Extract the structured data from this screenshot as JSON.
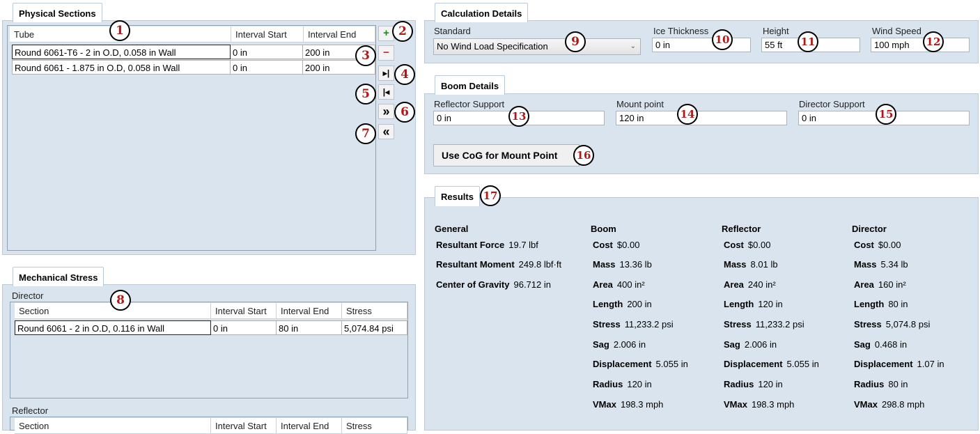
{
  "physical": {
    "title": "Physical Sections",
    "columns": [
      "Tube",
      "Interval Start",
      "Interval End"
    ],
    "rows": [
      [
        "Round 6061-T6 - 2 in O.D, 0.058 in Wall",
        "0 in",
        "200 in"
      ],
      [
        "Round 6061 - 1.875 in O.D, 0.058 in Wall",
        "0 in",
        "200 in"
      ]
    ],
    "buttons": {
      "add": "+",
      "remove": "−",
      "split": "▸|",
      "merge": "|◂",
      "expand": "»",
      "collapse": "«"
    }
  },
  "mechanical": {
    "title": "Mechanical Stress",
    "director_label": "Director",
    "columns": [
      "Section",
      "Interval Start",
      "Interval End",
      "Stress"
    ],
    "rows": [
      [
        "Round 6061 - 2 in O.D, 0.116 in Wall",
        "0 in",
        "80 in",
        "5,074.84 psi"
      ]
    ],
    "reflector_label": "Reflector",
    "reflector_columns": [
      "Section",
      "Interval Start",
      "Interval End",
      "Stress"
    ]
  },
  "calc": {
    "title": "Calculation Details",
    "standard_label": "Standard",
    "standard_value": "No Wind Load Specification",
    "ice_label": "Ice Thickness",
    "ice_value": "0 in",
    "height_label": "Height",
    "height_value": "55 ft",
    "wind_label": "Wind Speed",
    "wind_value": "100 mph"
  },
  "boom": {
    "title": "Boom Details",
    "reflector_label": "Reflector Support",
    "reflector_value": "0 in",
    "mount_label": "Mount point",
    "mount_value": "120 in",
    "director_label": "Director Support",
    "director_value": "0 in",
    "cog_button": "Use CoG for Mount Point"
  },
  "results": {
    "title": "Results",
    "general": {
      "heading": "General",
      "items": [
        {
          "label": "Resultant Force",
          "value": "19.7 lbf"
        },
        {
          "label": "Resultant Moment",
          "value": "249.8 lbf·ft"
        },
        {
          "label": "Center of Gravity",
          "value": "96.712 in"
        }
      ]
    },
    "columns": [
      {
        "heading": "Boom",
        "items": [
          {
            "label": "Cost",
            "value": "$0.00"
          },
          {
            "label": "Mass",
            "value": "13.36 lb"
          },
          {
            "label": "Area",
            "value": "400 in²"
          },
          {
            "label": "Length",
            "value": "200 in"
          },
          {
            "label": "Stress",
            "value": "11,233.2 psi"
          },
          {
            "label": "Sag",
            "value": "2.006 in"
          },
          {
            "label": "Displacement",
            "value": "5.055 in"
          },
          {
            "label": "Radius",
            "value": "120 in"
          },
          {
            "label": "VMax",
            "value": "198.3 mph"
          }
        ]
      },
      {
        "heading": "Reflector",
        "items": [
          {
            "label": "Cost",
            "value": "$0.00"
          },
          {
            "label": "Mass",
            "value": "8.01 lb"
          },
          {
            "label": "Area",
            "value": "240 in²"
          },
          {
            "label": "Length",
            "value": "120 in"
          },
          {
            "label": "Stress",
            "value": "11,233.2 psi"
          },
          {
            "label": "Sag",
            "value": "2.006 in"
          },
          {
            "label": "Displacement",
            "value": "5.055 in"
          },
          {
            "label": "Radius",
            "value": "120 in"
          },
          {
            "label": "VMax",
            "value": "198.3 mph"
          }
        ]
      },
      {
        "heading": "Director",
        "items": [
          {
            "label": "Cost",
            "value": "$0.00"
          },
          {
            "label": "Mass",
            "value": "5.34 lb"
          },
          {
            "label": "Area",
            "value": "160 in²"
          },
          {
            "label": "Length",
            "value": "80 in"
          },
          {
            "label": "Stress",
            "value": "5,074.8 psi"
          },
          {
            "label": "Sag",
            "value": "0.468 in"
          },
          {
            "label": "Displacement",
            "value": "1.07 in"
          },
          {
            "label": "Radius",
            "value": "80 in"
          },
          {
            "label": "VMax",
            "value": "298.8 mph"
          }
        ]
      }
    ]
  },
  "callouts": [
    "1",
    "2",
    "3",
    "4",
    "5",
    "6",
    "7",
    "8",
    "9",
    "10",
    "11",
    "12",
    "13",
    "14",
    "15",
    "16",
    "17"
  ],
  "colors": {
    "panel": "#d9e4ee",
    "callout_text": "#b01818",
    "add_green": "#1e8a1e",
    "remove_red": "#d42020"
  }
}
